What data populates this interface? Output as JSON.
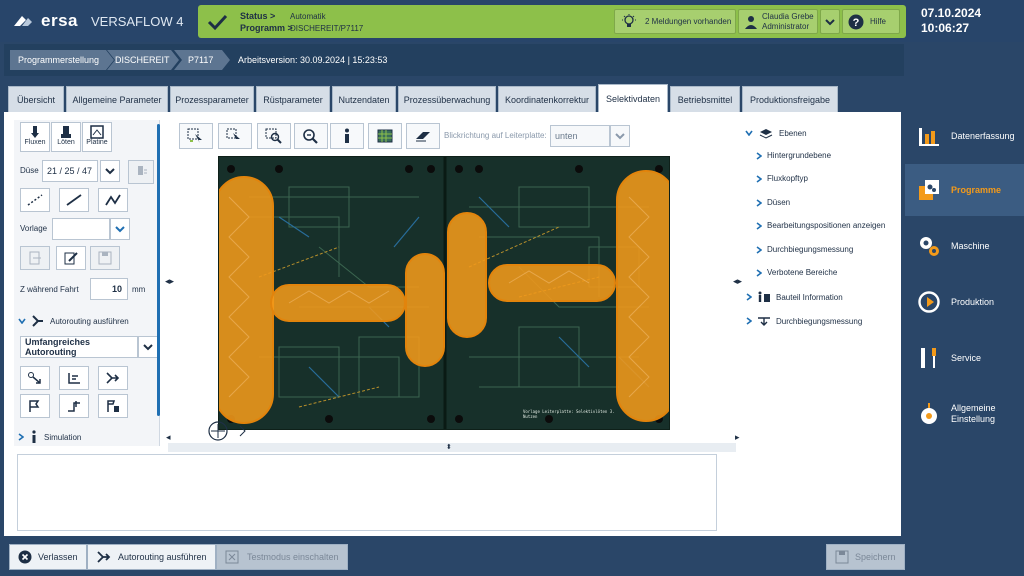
{
  "app": {
    "brand": "ersa",
    "product": "VERSAFLOW 4"
  },
  "status": {
    "status_label": "Status >",
    "status_value": "Automatik",
    "program_label": "Programm >",
    "program_value": "DISCHEREIT/P7117",
    "messages": "2 Meldungen vorhanden",
    "user_name": "Claudia Grebe",
    "user_role": "Administrator",
    "help": "Hilfe"
  },
  "clock": {
    "date": "07.10.2024",
    "time": "10:06:27"
  },
  "breadcrumb": [
    "Programmerstellung",
    "DISCHEREIT",
    "P7117"
  ],
  "version_text": "Arbeitsversion: 30.09.2024 | 15:23:53",
  "tabs": [
    "Übersicht",
    "Allgemeine Parameter",
    "Prozessparameter",
    "Rüstparameter",
    "Nutzendaten",
    "Prozessüberwachung",
    "Koordinatenkorrektur",
    "Selektivdaten",
    "Betriebsmittel",
    "Produktionsfreigabe"
  ],
  "active_tab": "Selektivdaten",
  "left_panel": {
    "mode_tabs": [
      "Fluxen",
      "Löten",
      "Platine"
    ],
    "duese_label": "Düse",
    "duese_value": "21 / 25 / 47",
    "vorlage_label": "Vorlage",
    "vorlage_value": "",
    "z_label": "Z während Fahrt",
    "z_value": "10",
    "z_unit": "mm",
    "autorouting_section": "Autorouting ausführen",
    "autorouting_mode": "Umfangreiches Autorouting",
    "simulation_section": "Simulation"
  },
  "toolbar": {
    "view_dir_label": "Blickrichtung auf Leiterplatte:",
    "view_dir_value": "unten"
  },
  "board": {
    "silkscreen_text": "Vorlage Leiterplatte: Selektivlöten 3. Nutzen"
  },
  "tree": {
    "root": "Ebenen",
    "children": [
      "Hintergrundebene",
      "Fluxkopftyp",
      "Düsen",
      "Bearbeitungspositionen anzeigen",
      "Durchbiegungsmessung",
      "Verbotene Bereiche"
    ],
    "others": [
      "Bauteil Information",
      "Durchbiegungsmessung"
    ]
  },
  "bottom": {
    "leave": "Verlassen",
    "autorouting": "Autorouting ausführen",
    "testmode": "Testmodus einschalten",
    "save": "Speichern"
  },
  "nav": {
    "items": [
      "Datenerfassung",
      "Programme",
      "Maschine",
      "Produktion",
      "Service",
      "Allgemeine Einstellung"
    ],
    "active": "Programme"
  },
  "colors": {
    "status_green": "#8dc04a",
    "accent_orange": "#f39a1a",
    "navy": "#2a4668",
    "pcb_green": "#17302a"
  }
}
